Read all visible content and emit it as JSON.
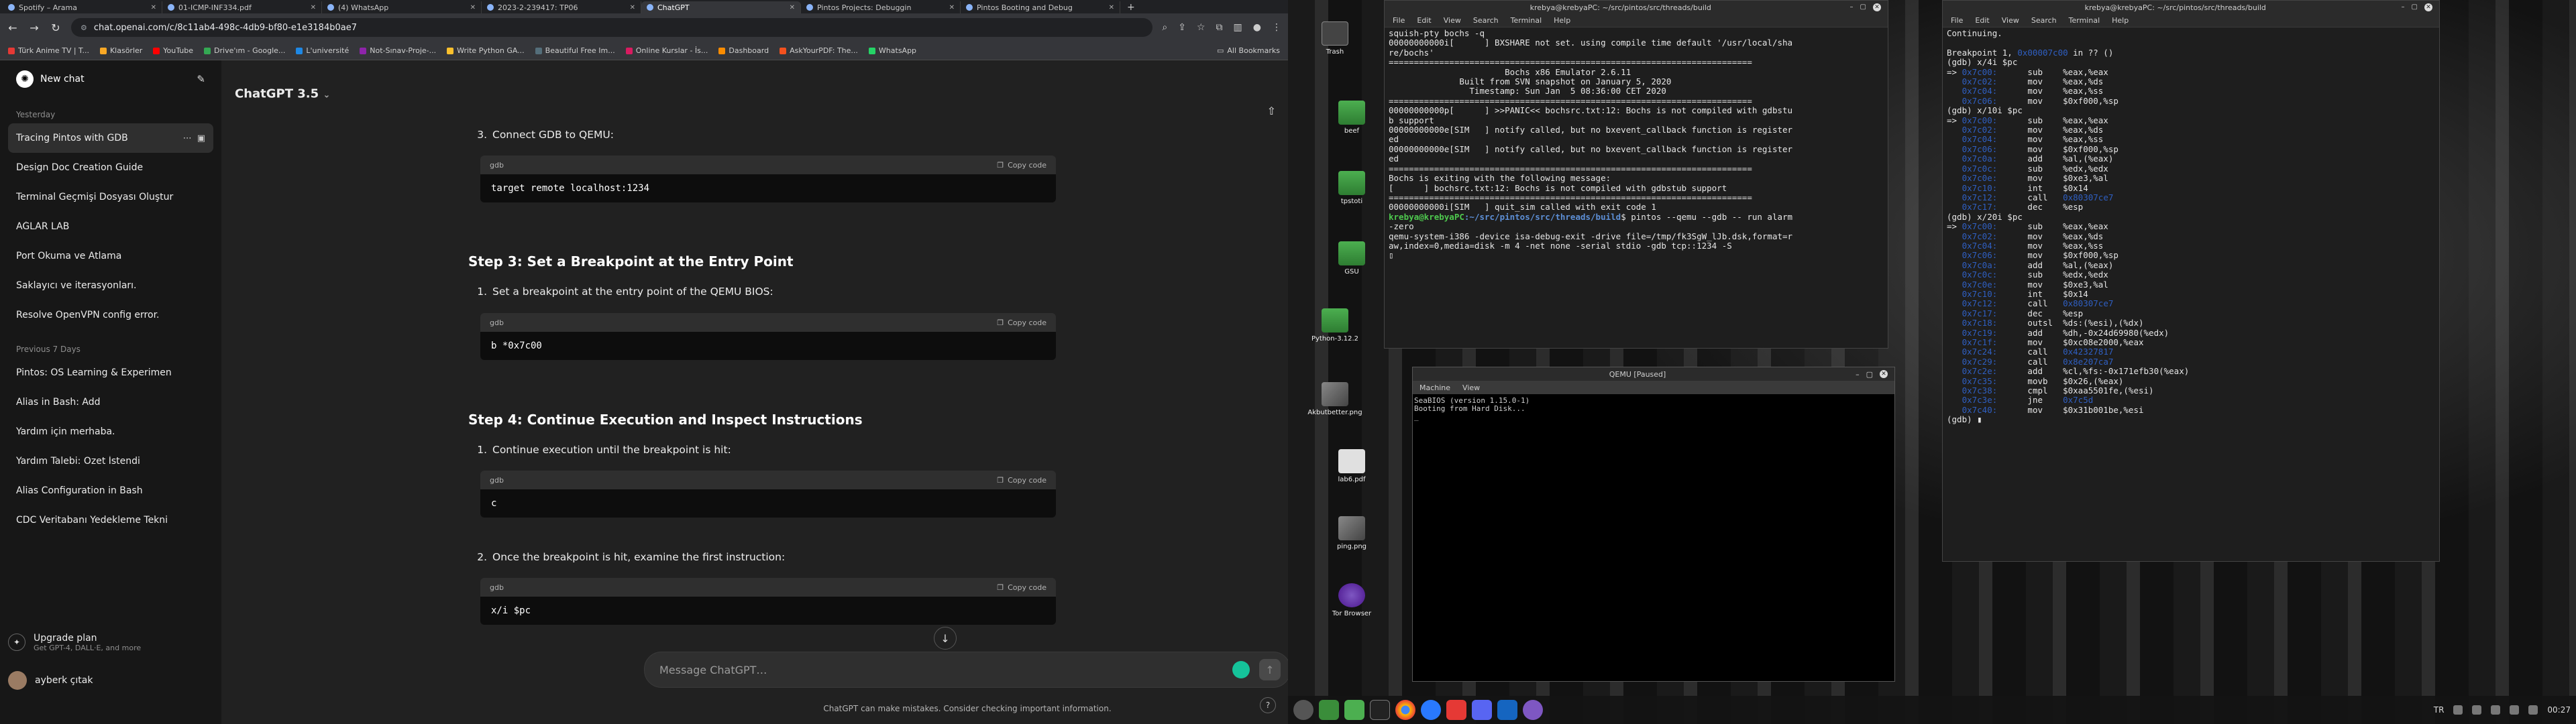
{
  "browser": {
    "tabs": [
      {
        "title": "Spotify – Arama",
        "active": false
      },
      {
        "title": "01-ICMP-INF334.pdf",
        "active": false
      },
      {
        "title": "(4) WhatsApp",
        "active": false
      },
      {
        "title": "2023-2-239417: TP06",
        "active": false
      },
      {
        "title": "ChatGPT",
        "active": true
      },
      {
        "title": "Pintos Projects: Debuggin",
        "active": false
      },
      {
        "title": "Pintos Booting and Debug",
        "active": false
      }
    ],
    "new_tab": "+",
    "url": "chat.openai.com/c/8c11ab4-498c-4db9-bf80-e1e3184b0ae7",
    "bookmarks": [
      {
        "label": "Türk Anime TV | T...",
        "color": "#e53935"
      },
      {
        "label": "Klasörler",
        "color": "#f9a825"
      },
      {
        "label": "YouTube",
        "color": "#ff0000"
      },
      {
        "label": "Drive'ım - Google...",
        "color": "#34a853"
      },
      {
        "label": "L'université",
        "color": "#1e88e5"
      },
      {
        "label": "Not-Sınav-Proje-...",
        "color": "#8e24aa"
      },
      {
        "label": "Write Python GA...",
        "color": "#fbc02d"
      },
      {
        "label": "Beautiful Free Im...",
        "color": "#546e7a"
      },
      {
        "label": "Online Kurslar - İs...",
        "color": "#d81b60"
      },
      {
        "label": "Dashboard",
        "color": "#fb8c00"
      },
      {
        "label": "AskYourPDF: The...",
        "color": "#f4511e"
      },
      {
        "label": "WhatsApp",
        "color": "#25d366"
      }
    ],
    "all_bookmarks": "All Bookmarks"
  },
  "sidebar": {
    "new_chat": "New chat",
    "section_yesterday": "Yesterday",
    "yesterday_items": [
      {
        "label": "Tracing Pintos with GDB",
        "active": true
      },
      {
        "label": "Design Doc Creation Guide",
        "active": false
      },
      {
        "label": "Terminal Geçmişi Dosyası Oluştur",
        "active": false
      },
      {
        "label": "AĞLAR LAB",
        "active": false
      },
      {
        "label": "Port Okuma ve Atlama",
        "active": false
      },
      {
        "label": "Saklayıcı ve iterasyonları.",
        "active": false
      },
      {
        "label": "Resolve OpenVPN config error.",
        "active": false
      }
    ],
    "section_prev7": "Previous 7 Days",
    "prev7_items": [
      {
        "label": "Pintos: OS Learning & Experimen"
      },
      {
        "label": "Alias in Bash: Add"
      },
      {
        "label": "Yardım için merhaba."
      },
      {
        "label": "Yardım Talebi: Özet İstendi"
      },
      {
        "label": "Alias Configuration in Bash"
      },
      {
        "label": "CDC Veritabanı Yedekleme Tekni"
      }
    ],
    "upgrade_title": "Upgrade plan",
    "upgrade_sub": "Get GPT-4, DALL·E, and more",
    "user_name": "ayberk çıtak"
  },
  "main": {
    "model": "ChatGPT 3.5",
    "item3": "Connect GDB to QEMU:",
    "code1": {
      "lang": "gdb",
      "copy": "Copy code",
      "code": "target remote localhost:1234"
    },
    "step3": "Step 3: Set a Breakpoint at the Entry Point",
    "step3_item1": "Set a breakpoint at the entry point of the QEMU BIOS:",
    "code2": {
      "lang": "gdb",
      "copy": "Copy code",
      "code": "b *0x7c00"
    },
    "step4": "Step 4: Continue Execution and Inspect Instructions",
    "step4_item1": "Continue execution until the breakpoint is hit:",
    "code3": {
      "lang": "gdb",
      "copy": "Copy code",
      "code": "c"
    },
    "step4_item2": "Once the breakpoint is hit, examine the first instruction:",
    "code4": {
      "lang": "gdb",
      "copy": "Copy code",
      "code": "x/i $pc"
    },
    "composer_placeholder": "Message ChatGPT…",
    "disclaimer": "ChatGPT can make mistakes. Consider checking important information.",
    "help": "?"
  },
  "desktop": {
    "icons": [
      {
        "label": "Trash",
        "kind": "trash"
      },
      {
        "label": "beef",
        "kind": "folder"
      },
      {
        "label": "tpstoti",
        "kind": "folder"
      },
      {
        "label": "GSU",
        "kind": "folder"
      },
      {
        "label": "Python-3.12.2",
        "kind": "folder"
      },
      {
        "label": "Akbutbetter.png",
        "kind": "img"
      },
      {
        "label": "lab6.pdf",
        "kind": "file"
      },
      {
        "label": "ping.png",
        "kind": "img"
      },
      {
        "label": "Tor Browser",
        "kind": "tor"
      }
    ],
    "term1": {
      "title": "krebya@krebyaPC: ~/src/pintos/src/threads/build",
      "menu": [
        "File",
        "Edit",
        "View",
        "Search",
        "Terminal",
        "Help"
      ],
      "lines": [
        "squish-pty bochs -q",
        "00000000000i[      ] BXSHARE not set. using compile time default '/usr/local/sha",
        "re/bochs'",
        "========================================================================",
        "                       Bochs x86 Emulator 2.6.11",
        "              Built from SVN snapshot on January 5, 2020",
        "                Timestamp: Sun Jan  5 08:36:00 CET 2020",
        "========================================================================",
        "00000000000p[      ] >>PANIC<< bochsrc.txt:12: Bochs is not compiled with gdbstu",
        "b support",
        "00000000000e[SIM   ] notify called, but no bxevent_callback function is register",
        "ed",
        "00000000000e[SIM   ] notify called, but no bxevent_callback function is register",
        "ed",
        "========================================================================",
        "Bochs is exiting with the following message:",
        "[      ] bochsrc.txt:12: Bochs is not compiled with gdbstub support",
        "========================================================================",
        "00000000000i[SIM   ] quit_sim called with exit code 1"
      ],
      "prompt_user": "krebya@krebyaPC",
      "prompt_path": ":~/src/pintos/src/threads/build",
      "prompt_cmd": "$ pintos --qemu --gdb -- run alarm",
      "after_prompt": [
        "-zero",
        "qemu-system-i386 -device isa-debug-exit -drive file=/tmp/fk3SgW_lJb.dsk,format=r",
        "aw,index=0,media=disk -m 4 -net none -serial stdio -gdb tcp::1234 -S"
      ]
    },
    "qemu": {
      "title": "QEMU [Paused]",
      "menu": [
        "Machine",
        "View"
      ],
      "lines": [
        "SeaBIOS (version 1.15.0-1)",
        "Booting from Hard Disk...",
        "_"
      ]
    },
    "term2": {
      "title": "krebya@krebyaPC: ~/src/pintos/src/threads/build",
      "menu": [
        "File",
        "Edit",
        "View",
        "Search",
        "Terminal",
        "Help"
      ],
      "text": "Continuing.\n\nBreakpoint 1, 0x00007c00 in ?? ()\n(gdb) x/4i $pc\n=> 0x7c00:\tsub    %eax,%eax\n   0x7c02:\tmov    %eax,%ds\n   0x7c04:\tmov    %eax,%ss\n   0x7c06:\tmov    $0xf000,%sp\n(gdb) x/10i $pc\n=> 0x7c00:\tsub    %eax,%eax\n   0x7c02:\tmov    %eax,%ds\n   0x7c04:\tmov    %eax,%ss\n   0x7c06:\tmov    $0xf000,%sp\n   0x7c0a:\tadd    %al,(%eax)\n   0x7c0c:\tsub    %edx,%edx\n   0x7c0e:\tmov    $0xe3,%al\n   0x7c10:\tint    $0x14\n   0x7c12:\tcall   0x80307ce7\n   0x7c17:\tdec    %esp\n(gdb) x/20i $pc\n=> 0x7c00:\tsub    %eax,%eax\n   0x7c02:\tmov    %eax,%ds\n   0x7c04:\tmov    %eax,%ss\n   0x7c06:\tmov    $0xf000,%sp\n   0x7c0a:\tadd    %al,(%eax)\n   0x7c0c:\tsub    %edx,%edx\n   0x7c0e:\tmov    $0xe3,%al\n   0x7c10:\tint    $0x14\n   0x7c12:\tcall   0x80307ce7\n   0x7c17:\tdec    %esp\n   0x7c18:\toutsl  %ds:(%esi),(%dx)\n   0x7c19:\tadd    %dh,-0x24d69980(%edx)\n   0x7c1f:\tmov    $0xc08e2000,%eax\n   0x7c24:\tcall   0x42327817\n   0x7c29:\tcall   0x8e207ca7\n   0x7c2e:\tadd    %cl,%fs:-0x171efb30(%eax)\n   0x7c35:\tmovb   $0x26,(%eax)\n   0x7c38:\tcmpl   $0xaa5501fe,(%esi)\n   0x7c3e:\tjne    0x7c5d\n   0x7c40:\tmov    $0x31b001be,%esi\n(gdb) ",
      "bp_addr": "0x00007c00"
    },
    "tray": {
      "lang": "TR",
      "time": "00:27"
    }
  }
}
